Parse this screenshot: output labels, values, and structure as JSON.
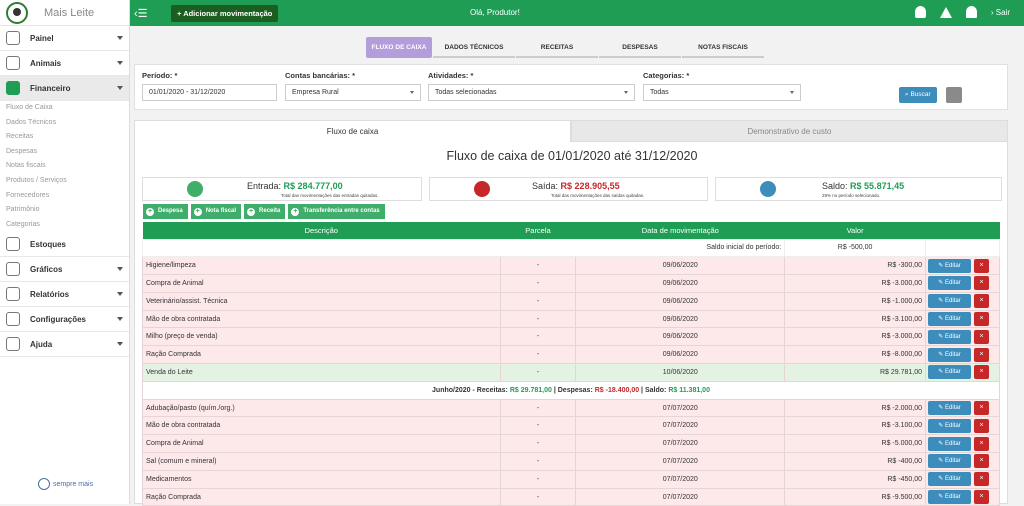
{
  "app": {
    "name": "Mais Leite",
    "footer_brand": "sempre mais"
  },
  "topbar": {
    "menu_icon": "hamburger-icon",
    "add_button": "Adicionar movimentação",
    "greeting": "Olá, Produtor!",
    "logout": "Sair"
  },
  "sidebar": {
    "items": [
      {
        "label": "Painel",
        "icon": "dashboard-icon"
      },
      {
        "label": "Animais",
        "icon": "cow-icon"
      },
      {
        "label": "Financeiro",
        "icon": "calculator-icon"
      },
      {
        "label": "Estoques",
        "icon": "warehouse-icon"
      },
      {
        "label": "Gráficos",
        "icon": "chart-icon"
      },
      {
        "label": "Relatórios",
        "icon": "report-icon"
      },
      {
        "label": "Configurações",
        "icon": "gear-icon"
      },
      {
        "label": "Ajuda",
        "icon": "help-icon"
      }
    ],
    "sub": [
      "Fluxo de Caixa",
      "Dados Técnicos",
      "Receitas",
      "Despesas",
      "Notas fiscais",
      "Produtos / Serviços",
      "Fornecedores",
      "Patrimônio",
      "Categorias"
    ]
  },
  "tabs": [
    "FLUXO DE CAIXA",
    "DADOS TÉCNICOS",
    "RECEITAS",
    "DESPESAS",
    "NOTAS FISCAIS"
  ],
  "filters": {
    "periodo": {
      "label": "Período: *",
      "value": "01/01/2020 - 31/12/2020"
    },
    "contas": {
      "label": "Contas bancárias: *",
      "value": "Empresa Rural"
    },
    "atividades": {
      "label": "Atividades: *",
      "value": "Todas selecionadas"
    },
    "categorias": {
      "label": "Categorias: *",
      "value": "Todas"
    },
    "buscar": "Buscar"
  },
  "content_tabs": [
    "Fluxo de caixa",
    "Demonstrativo de custo"
  ],
  "title": "Fluxo de caixa de 01/01/2020 até 31/12/2020",
  "summary": {
    "entrada": {
      "label": "Entrada:",
      "value": "R$ 284.777,00",
      "sub": "Total das movimentações das entradas quitadas."
    },
    "saida": {
      "label": "Saída:",
      "value": "R$ 228.905,55",
      "sub": "Total das movimentações das saídas quitadas."
    },
    "saldo": {
      "label": "Saldo:",
      "value": "R$ 55.871,45",
      "sub": "29% no período selecionado."
    }
  },
  "actions": [
    "Despesa",
    "Nota fiscal",
    "Receita",
    "Transferência entre contas"
  ],
  "table": {
    "headers": [
      "Descrição",
      "Parcela",
      "Data de movimentação",
      "Valor"
    ],
    "initial": {
      "label": "Saldo inicial do período:",
      "value": "R$ -500,00"
    },
    "edit_label": "Editar",
    "month_summary": {
      "prefix": "Junho/2020 - Receitas:",
      "rec": "R$ 29.781,00",
      "desp_label": " | Despesas:",
      "desp": "R$ -18.400,00",
      "saldo_label": " | Saldo:",
      "saldo": "R$ 11.381,00"
    },
    "rows_a": [
      {
        "desc": "Higiene/limpeza",
        "parc": "-",
        "date": "09/06/2020",
        "value": "R$ -300,00",
        "type": "exp"
      },
      {
        "desc": "Compra de Animal",
        "parc": "-",
        "date": "09/06/2020",
        "value": "R$ -3.000,00",
        "type": "exp"
      },
      {
        "desc": "Veterinário/assist. Técnica",
        "parc": "-",
        "date": "09/06/2020",
        "value": "R$ -1.000,00",
        "type": "exp"
      },
      {
        "desc": "Mão de obra contratada",
        "parc": "-",
        "date": "09/06/2020",
        "value": "R$ -3.100,00",
        "type": "exp"
      },
      {
        "desc": "Milho (preço de venda)",
        "parc": "-",
        "date": "09/06/2020",
        "value": "R$ -3.000,00",
        "type": "exp"
      },
      {
        "desc": "Ração Comprada",
        "parc": "-",
        "date": "09/06/2020",
        "value": "R$ -8.000,00",
        "type": "exp"
      },
      {
        "desc": "Venda do Leite",
        "parc": "-",
        "date": "10/06/2020",
        "value": "R$ 29.781,00",
        "type": "inc"
      }
    ],
    "rows_b": [
      {
        "desc": "Adubação/pasto (quím./org.)",
        "parc": "-",
        "date": "07/07/2020",
        "value": "R$ -2.000,00",
        "type": "exp"
      },
      {
        "desc": "Mão de obra contratada",
        "parc": "-",
        "date": "07/07/2020",
        "value": "R$ -3.100,00",
        "type": "exp"
      },
      {
        "desc": "Compra de Animal",
        "parc": "-",
        "date": "07/07/2020",
        "value": "R$ -5.000,00",
        "type": "exp"
      },
      {
        "desc": "Sal (comum e mineral)",
        "parc": "-",
        "date": "07/07/2020",
        "value": "R$ -400,00",
        "type": "exp"
      },
      {
        "desc": "Medicamentos",
        "parc": "-",
        "date": "07/07/2020",
        "value": "R$ -450,00",
        "type": "exp"
      },
      {
        "desc": "Ração Comprada",
        "parc": "-",
        "date": "07/07/2020",
        "value": "R$ -9.500,00",
        "type": "exp"
      }
    ]
  },
  "colors": {
    "brand": "#1f9d55",
    "dark_green": "#1b5e20",
    "purple": "#b39ddb",
    "edit": "#3c8dbc",
    "delete": "#c62828",
    "expense_row": "#fde8ea",
    "income_row": "#e4f2e4"
  }
}
